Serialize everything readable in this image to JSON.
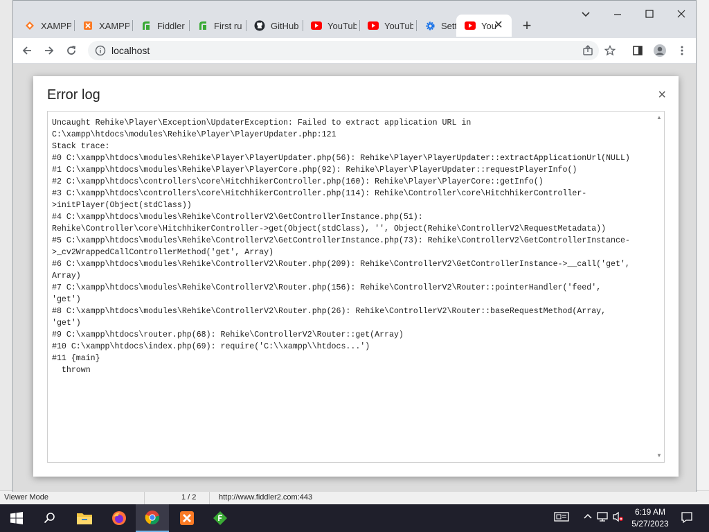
{
  "tabs": [
    {
      "label": "XAMPP",
      "icon": "xampp-icon"
    },
    {
      "label": "XAMPP",
      "icon": "xampp-icon"
    },
    {
      "label": "Fiddler",
      "icon": "fiddler-icon"
    },
    {
      "label": "First ru",
      "icon": "fiddler-icon"
    },
    {
      "label": "GitHub",
      "icon": "github-icon"
    },
    {
      "label": "YouTub",
      "icon": "youtube-icon"
    },
    {
      "label": "YouTub",
      "icon": "youtube-icon"
    },
    {
      "label": "Setting",
      "icon": "gear-icon"
    },
    {
      "label": "You",
      "icon": "youtube-icon"
    }
  ],
  "address": {
    "url": "localhost"
  },
  "modal": {
    "title": "Error log",
    "close": "×",
    "log": "Uncaught Rehike\\Player\\Exception\\UpdaterException: Failed to extract application URL in\nC:\\xampp\\htdocs\\modules\\Rehike\\Player\\PlayerUpdater.php:121\nStack trace:\n#0 C:\\xampp\\htdocs\\modules\\Rehike\\Player\\PlayerUpdater.php(56): Rehike\\Player\\PlayerUpdater::extractApplicationUrl(NULL)\n#1 C:\\xampp\\htdocs\\modules\\Rehike\\Player\\PlayerCore.php(92): Rehike\\Player\\PlayerUpdater::requestPlayerInfo()\n#2 C:\\xampp\\htdocs\\controllers\\core\\HitchhikerController.php(160): Rehike\\Player\\PlayerCore::getInfo()\n#3 C:\\xampp\\htdocs\\controllers\\core\\HitchhikerController.php(114): Rehike\\Controller\\core\\HitchhikerController-\n>initPlayer(Object(stdClass))\n#4 C:\\xampp\\htdocs\\modules\\Rehike\\ControllerV2\\GetControllerInstance.php(51):\nRehike\\Controller\\core\\HitchhikerController->get(Object(stdClass), '', Object(Rehike\\ControllerV2\\RequestMetadata))\n#5 C:\\xampp\\htdocs\\modules\\Rehike\\ControllerV2\\GetControllerInstance.php(73): Rehike\\ControllerV2\\GetControllerInstance-\n>_cv2WrappedCallControllerMethod('get', Array)\n#6 C:\\xampp\\htdocs\\modules\\Rehike\\ControllerV2\\Router.php(209): Rehike\\ControllerV2\\GetControllerInstance->__call('get',\nArray)\n#7 C:\\xampp\\htdocs\\modules\\Rehike\\ControllerV2\\Router.php(156): Rehike\\ControllerV2\\Router::pointerHandler('feed',\n'get')\n#8 C:\\xampp\\htdocs\\modules\\Rehike\\ControllerV2\\Router.php(26): Rehike\\ControllerV2\\Router::baseRequestMethod(Array,\n'get')\n#9 C:\\xampp\\htdocs\\router.php(68): Rehike\\ControllerV2\\Router::get(Array)\n#10 C:\\xampp\\htdocs\\index.php(69): require('C:\\\\xampp\\\\htdocs...')\n#11 {main}\n  thrown"
  },
  "status_bar": {
    "viewer_mode": "Viewer Mode",
    "page": "1 / 2",
    "url": "http://www.fiddler2.com:443"
  },
  "taskbar": {
    "time": "6:19 AM",
    "date": "5/27/2023",
    "apps": [
      "windows-start-icon",
      "search-icon",
      "file-explorer-icon",
      "firefox-icon",
      "chrome-icon",
      "xampp-icon",
      "fiddler-icon"
    ]
  },
  "colors": {
    "xampp": "#fb7a24",
    "youtube": "#ff0000",
    "fiddler": "#3aaa35",
    "chrome_blue": "#1a73e8",
    "taskbar": "#1f1f2b"
  }
}
